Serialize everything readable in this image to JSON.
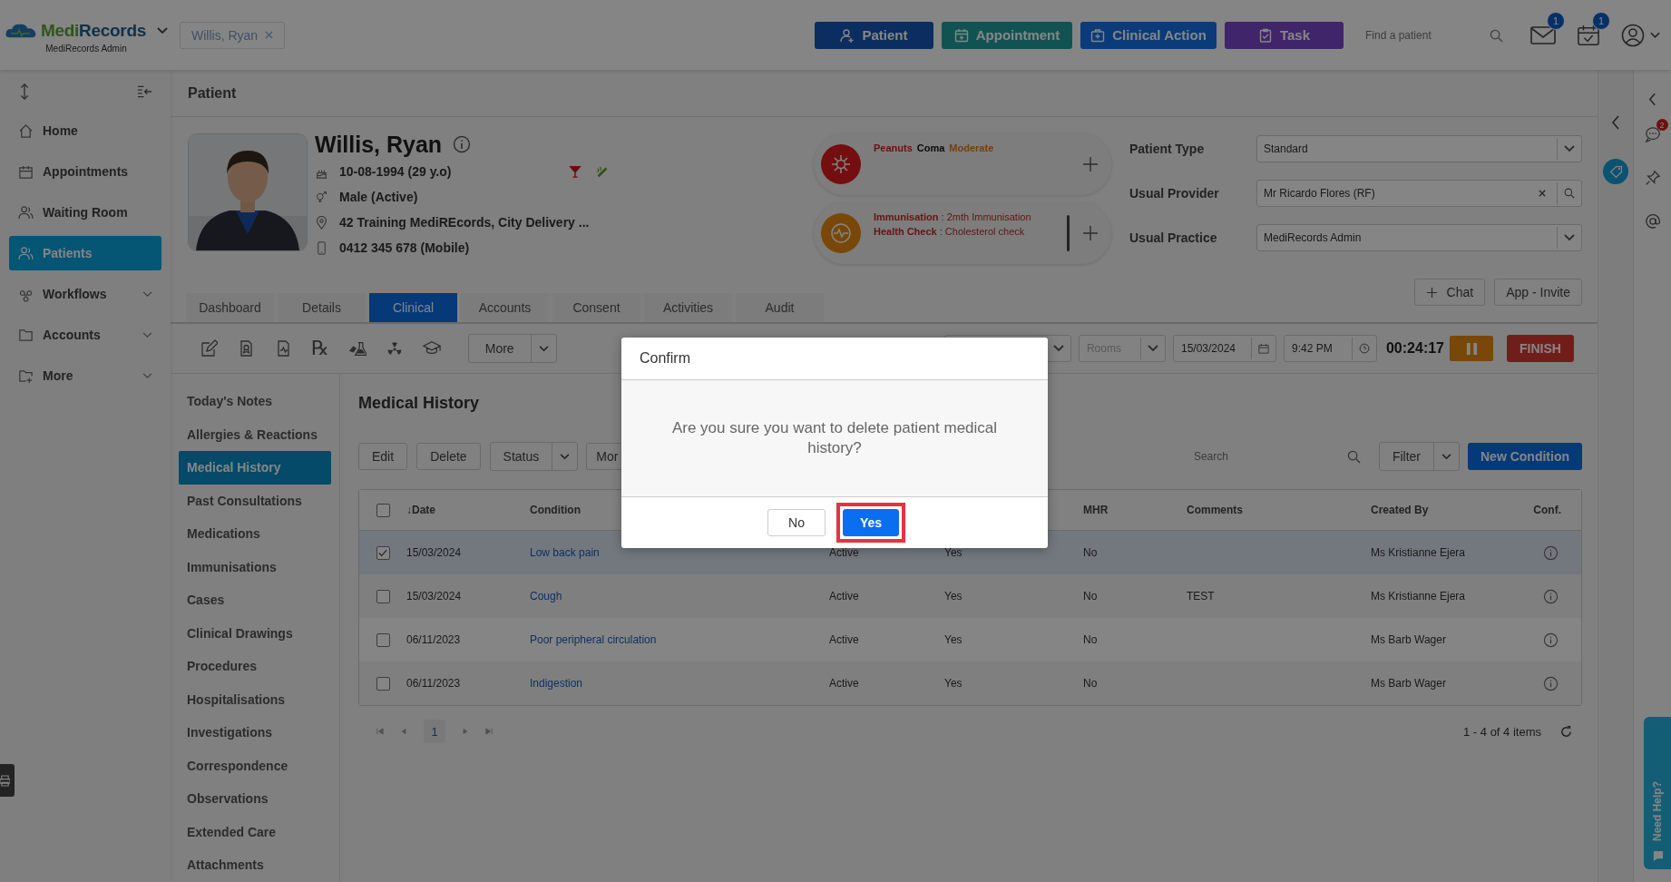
{
  "app": {
    "brand_first": "Medi",
    "brand_second": "Records",
    "account": "MediRecords Admin"
  },
  "open_patient": {
    "label": "Willis, Ryan"
  },
  "actions": [
    {
      "label": "Patient",
      "kind": "patient"
    },
    {
      "label": "Appointment",
      "kind": "appointment"
    },
    {
      "label": "Clinical Action",
      "kind": "clinical"
    },
    {
      "label": "Task",
      "kind": "task"
    }
  ],
  "find_patient": {
    "placeholder": "Find a patient"
  },
  "notifications": [
    {
      "kind": "mail",
      "count": "1"
    },
    {
      "kind": "calendar",
      "count": "1"
    }
  ],
  "sidebar": {
    "items": [
      {
        "label": "Home",
        "kind": "home",
        "selected": false,
        "has_submenu": false
      },
      {
        "label": "Appointments",
        "kind": "calendar",
        "selected": false,
        "has_submenu": false
      },
      {
        "label": "Waiting Room",
        "kind": "waiting",
        "selected": false,
        "has_submenu": false
      },
      {
        "label": "Patients",
        "kind": "patients",
        "selected": true,
        "has_submenu": false
      },
      {
        "label": "Workflows",
        "kind": "workflows",
        "selected": false,
        "has_submenu": true
      },
      {
        "label": "Accounts",
        "kind": "folder",
        "selected": false,
        "has_submenu": true
      },
      {
        "label": "More",
        "kind": "folder-plus",
        "selected": false,
        "has_submenu": true
      }
    ]
  },
  "page_title": "Patient",
  "patient": {
    "name": "Willis, Ryan",
    "dob": "10-08-1994 (29 y.o)",
    "gender": "Male (Active)",
    "address": "42 Training MediREcords, City Delivery ...",
    "phone": "0412 345 678 (Mobile)"
  },
  "alerts": [
    {
      "kind": "allergy",
      "segments": [
        {
          "text": "Peanuts",
          "kind": "allergen"
        },
        {
          "text": "Coma",
          "kind": "reaction"
        },
        {
          "text": "Moderate",
          "kind": "severity"
        }
      ]
    },
    {
      "kind": "reminder",
      "lines": [
        "**Immunisation** : 2mth Immunisation",
        "**Health Check** : Cholesterol check"
      ]
    }
  ],
  "fields": [
    {
      "label": "Patient Type",
      "value": "Standard",
      "kind": "select"
    },
    {
      "label": "Usual Provider",
      "value": "Mr Ricardo Flores (RF)",
      "kind": "lookup"
    },
    {
      "label": "Usual Practice",
      "value": "MediRecords Admin",
      "kind": "select"
    }
  ],
  "patient_buttons": [
    {
      "label": "Chat",
      "kind": "add"
    },
    {
      "label": "App - Invite",
      "kind": "plain"
    }
  ],
  "tabs": [
    {
      "label": "Dashboard",
      "selected": false
    },
    {
      "label": "Details",
      "selected": false
    },
    {
      "label": "Clinical",
      "selected": true
    },
    {
      "label": "Accounts",
      "selected": false
    },
    {
      "label": "Consent",
      "selected": false
    },
    {
      "label": "Activities",
      "selected": false
    },
    {
      "label": "Audit",
      "selected": false
    }
  ],
  "toolbar": {
    "rx_glyph": "℞",
    "more": "More",
    "rooms_placeholder": "Rooms",
    "date": "15/03/2024",
    "time": "9:42 PM",
    "timer": "00:24:17",
    "finish": "FINISH"
  },
  "subnav": [
    {
      "label": "Today's Notes",
      "selected": false
    },
    {
      "label": "Allergies & Reactions",
      "selected": false
    },
    {
      "label": "Medical History",
      "selected": true
    },
    {
      "label": "Past Consultations",
      "selected": false
    },
    {
      "label": "Medications",
      "selected": false
    },
    {
      "label": "Immunisations",
      "selected": false
    },
    {
      "label": "Cases",
      "selected": false
    },
    {
      "label": "Clinical Drawings",
      "selected": false
    },
    {
      "label": "Procedures",
      "selected": false
    },
    {
      "label": "Hospitalisations",
      "selected": false
    },
    {
      "label": "Investigations",
      "selected": false
    },
    {
      "label": "Correspondence",
      "selected": false
    },
    {
      "label": "Observations",
      "selected": false
    },
    {
      "label": "Extended Care",
      "selected": false
    },
    {
      "label": "Attachments",
      "selected": false
    }
  ],
  "history": {
    "title": "Medical History",
    "buttons": [
      "Edit",
      "Delete"
    ],
    "status": "Status",
    "more": "Mor",
    "all_selected": false,
    "search_placeholder": "Search",
    "filter": "Filter",
    "new_button": "New Condition",
    "columns": [
      {
        "kind": "sorted",
        "label": "Date",
        "sort_mark": "↓"
      },
      {
        "kind": "text",
        "label": "Condition"
      },
      {
        "kind": "covered"
      },
      {
        "kind": "covered"
      },
      {
        "kind": "text",
        "label": "MHR"
      },
      {
        "kind": "text",
        "label": "Comments"
      },
      {
        "kind": "text",
        "label": "Created By"
      },
      {
        "kind": "text",
        "label": "Conf."
      }
    ],
    "rows": [
      {
        "selected": true,
        "cells": [
          "15/03/2024",
          "Low back pain",
          "Active",
          "Yes",
          "No",
          null,
          "Ms Kristianne Ejera"
        ]
      },
      {
        "selected": false,
        "cells": [
          "15/03/2024",
          "Cough",
          "Active",
          "Yes",
          "No",
          "TEST",
          "Ms Kristianne Ejera"
        ]
      },
      {
        "selected": false,
        "cells": [
          "06/11/2023",
          "Poor peripheral circulation",
          "Active",
          "Yes",
          "No",
          null,
          "Ms Barb Wager"
        ]
      },
      {
        "selected": false,
        "cells": [
          "06/11/2023",
          "Indigestion",
          "Active",
          "Yes",
          "No",
          null,
          "Ms Barb Wager"
        ]
      }
    ],
    "page": "1",
    "summary": "1 - 4 of 4 items"
  },
  "side_badge": "2",
  "help_tab": "Need Help?",
  "dialog": {
    "title": "Confirm",
    "message": "Are you sure you want to delete patient medical history?",
    "buttons": [
      {
        "label": "No",
        "kind": "secondary",
        "highlighted": false
      },
      {
        "label": "Yes",
        "kind": "primary",
        "highlighted": true
      }
    ]
  }
}
